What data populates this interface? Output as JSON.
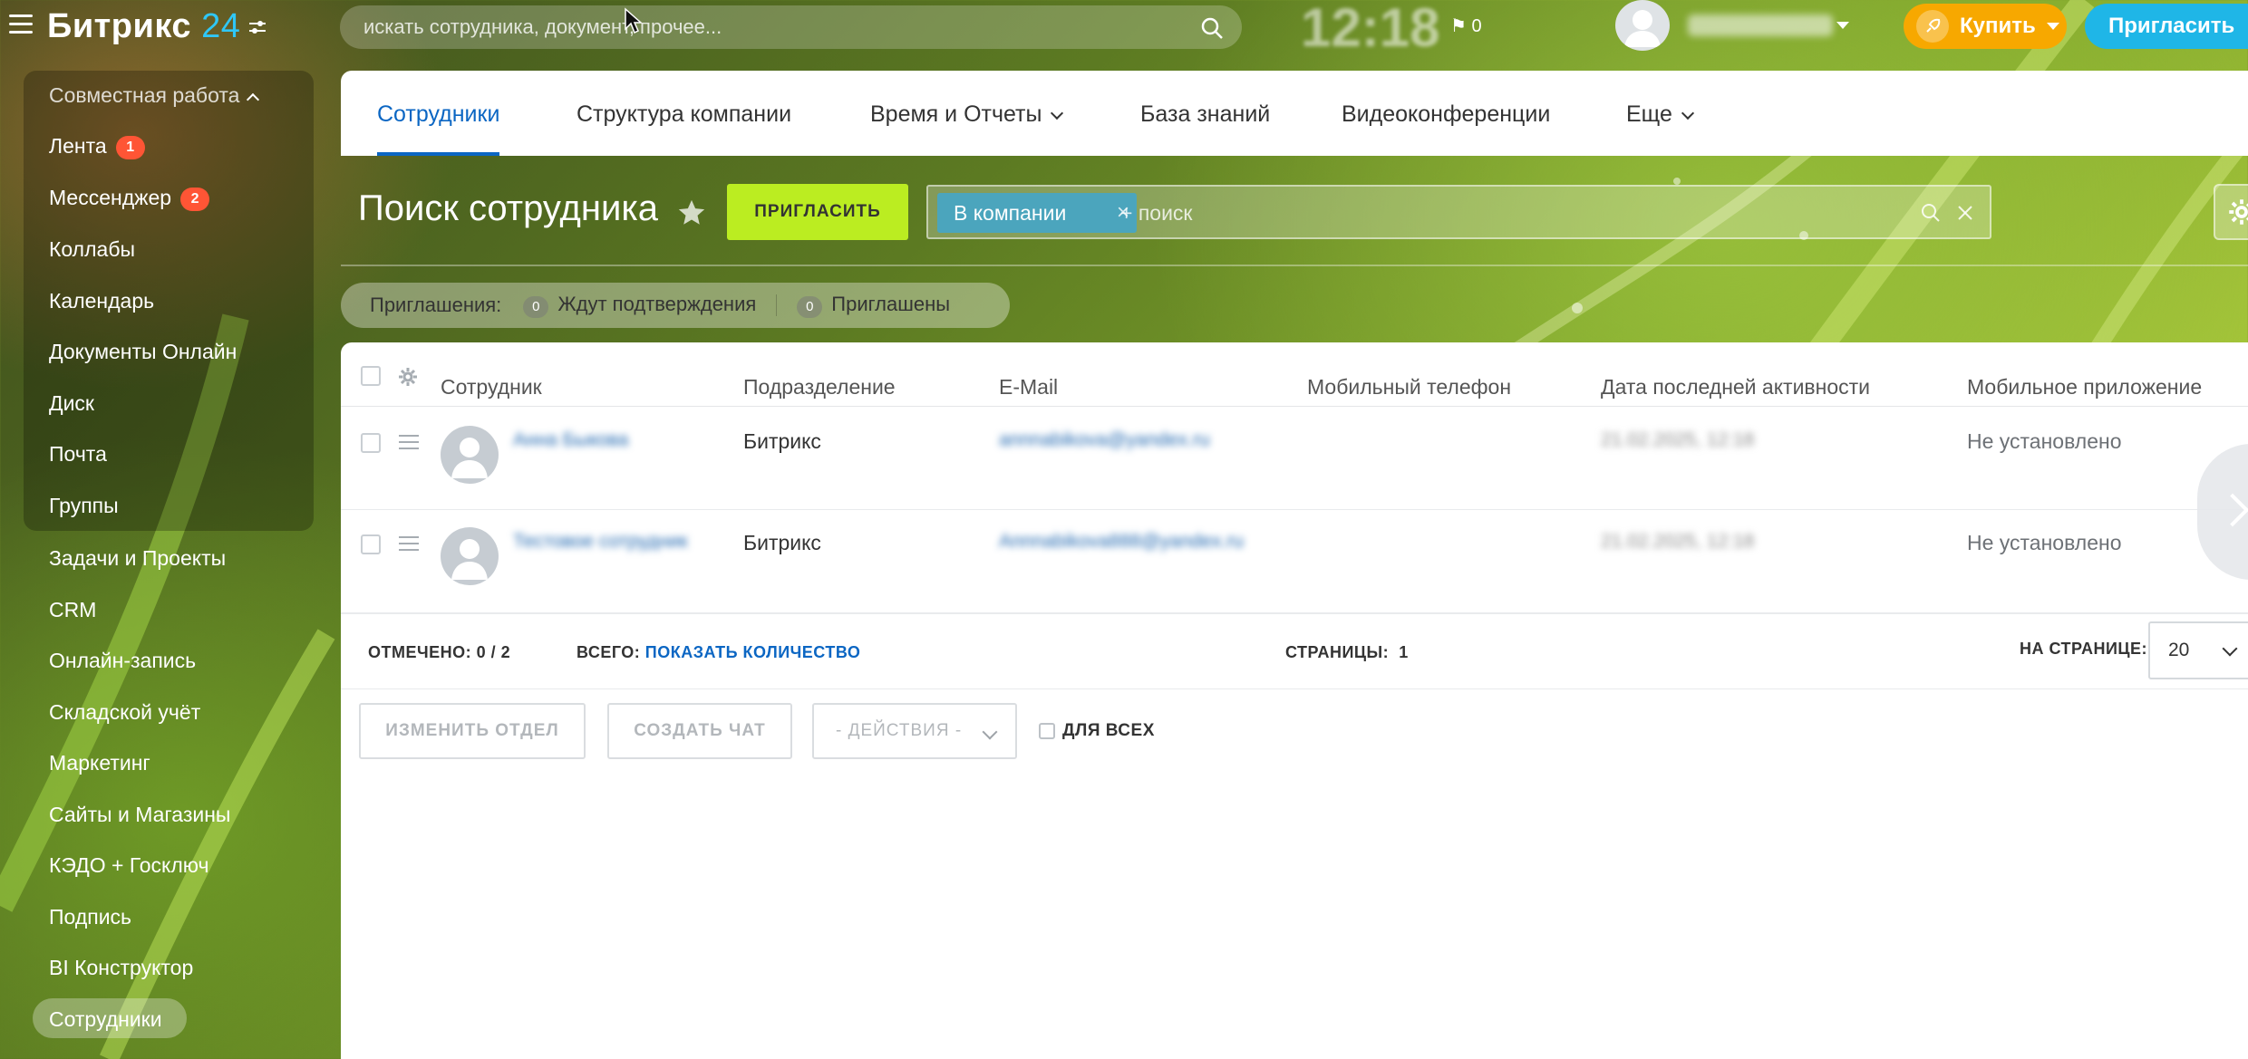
{
  "topbar": {
    "logo_text": "Битрикс",
    "logo_num": "24",
    "search_placeholder": "искать сотрудника, документ, прочее...",
    "clock": "12:18",
    "flag_count": "0",
    "buy_label": "Купить",
    "invite_label": "Пригласить"
  },
  "sidebar": {
    "group_title": "Совместная работа",
    "group_items": [
      {
        "label": "Лента",
        "badge": "1"
      },
      {
        "label": "Мессенджер",
        "badge": "2"
      },
      {
        "label": "Коллабы"
      },
      {
        "label": "Календарь"
      },
      {
        "label": "Документы Онлайн"
      },
      {
        "label": "Диск"
      },
      {
        "label": "Почта"
      },
      {
        "label": "Группы"
      }
    ],
    "items": [
      {
        "label": "Задачи и Проекты"
      },
      {
        "label": "CRM"
      },
      {
        "label": "Онлайн-запись"
      },
      {
        "label": "Складской учёт"
      },
      {
        "label": "Маркетинг"
      },
      {
        "label": "Сайты и Магазины"
      },
      {
        "label": "КЭДО + Госключ"
      },
      {
        "label": "Подпись"
      },
      {
        "label": "BI Конструктор"
      },
      {
        "label": "Сотрудники",
        "active": true
      }
    ]
  },
  "nav": {
    "tabs": [
      {
        "label": "Сотрудники",
        "active": true
      },
      {
        "label": "Структура компании"
      },
      {
        "label": "Время и Отчеты",
        "dropdown": true
      },
      {
        "label": "База знаний"
      },
      {
        "label": "Видеоконференции"
      },
      {
        "label": "Еще",
        "dropdown": true
      }
    ]
  },
  "page": {
    "title": "Поиск сотрудника",
    "invite_button": "ПРИГЛАСИТЬ",
    "filter_tag": "В компании",
    "filter_placeholder": "+ поиск"
  },
  "invitations": {
    "label": "Приглашения:",
    "pending_count": "0",
    "pending_label": "Ждут подтверждения",
    "invited_count": "0",
    "invited_label": "Приглашены"
  },
  "table": {
    "columns": [
      "Сотрудник",
      "Подразделение",
      "E-Mail",
      "Мобильный телефон",
      "Дата последней активности",
      "Мобильное приложение"
    ],
    "rows": [
      {
        "name": "Анна Быкова",
        "department": "Битрикс",
        "email": "annnabikova@yandex.ru",
        "phone": "",
        "last_activity": "21.02.2025, 12:18",
        "mobile_app": "Не установлено"
      },
      {
        "name": "Тестовое сотрудник",
        "department": "Битрикс",
        "email": "Annnabikova888@yandex.ru",
        "phone": "",
        "last_activity": "21.02.2025, 12:18",
        "mobile_app": "Не установлено"
      }
    ]
  },
  "footer": {
    "marked_label": "ОТМЕЧЕНО:",
    "marked_value": "0 / 2",
    "total_label": "ВСЕГО:",
    "total_link": "ПОКАЗАТЬ КОЛИЧЕСТВО",
    "pages_label": "СТРАНИЦЫ:",
    "pages_value": "1",
    "per_page_label": "НА СТРАНИЦЕ:",
    "per_page_value": "20"
  },
  "actions": {
    "change_dept": "ИЗМЕНИТЬ ОТДЕЛ",
    "create_chat": "СОЗДАТЬ ЧАТ",
    "actions_select": "- ДЕЙСТВИЯ -",
    "for_all": "ДЛЯ ВСЕХ"
  },
  "colors": {
    "accent_blue": "#0b66c3",
    "invite_green": "#bbed21",
    "buy_orange": "#f7a800",
    "invite_cyan": "#1fb6e7",
    "badge_red": "#ff5535",
    "filter_tag": "#4ba5bd"
  }
}
